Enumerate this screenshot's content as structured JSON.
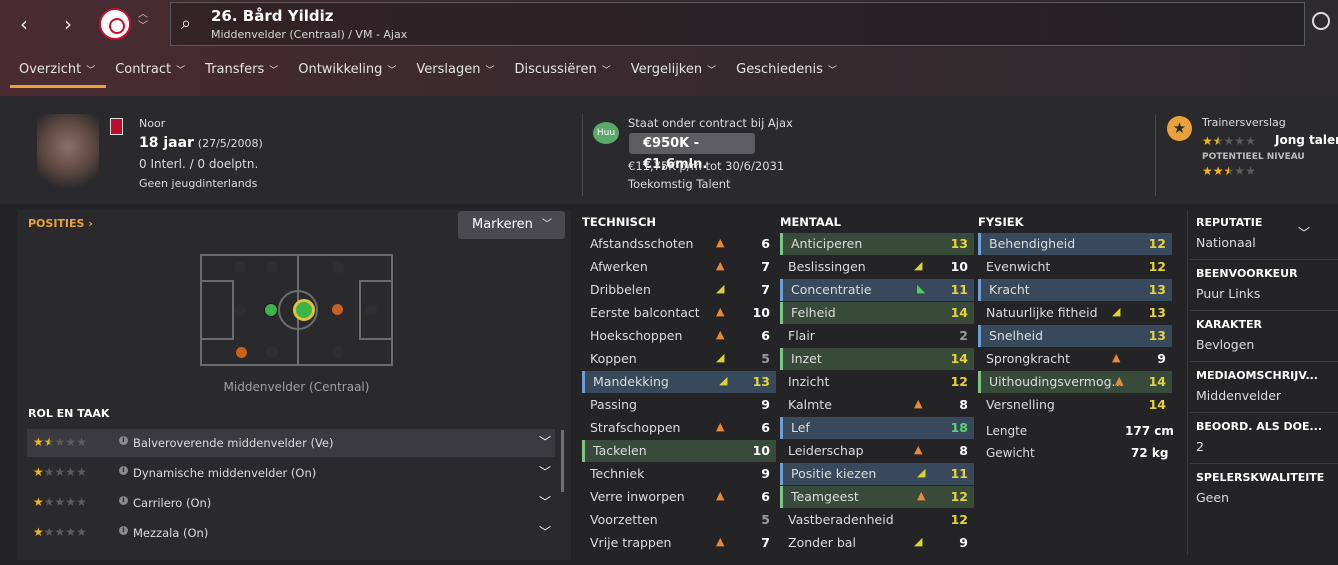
{
  "header": {
    "title": "26. Bård Yildiz",
    "subtitle": "Middenvelder (Centraal) / VM - Ajax"
  },
  "tabs": [
    {
      "label": "Overzicht"
    },
    {
      "label": "Contract"
    },
    {
      "label": "Transfers"
    },
    {
      "label": "Ontwikkeling"
    },
    {
      "label": "Verslagen"
    },
    {
      "label": "Discussiëren"
    },
    {
      "label": "Vergelijken"
    },
    {
      "label": "Geschiedenis"
    }
  ],
  "profile": {
    "nationality": "Noor",
    "age": "18 jaar",
    "dob": "(27/5/2008)",
    "caps": "0 Interl. / 0 doelptn.",
    "youth_caps": "Geen jeugdinterlands"
  },
  "contract": {
    "badge": "Huu",
    "status": "Staat onder contract bij Ajax",
    "value": "€950K - €1,6mln.",
    "wage": "€11,75K p/m tot 30/6/2031",
    "label": "Toekomstig Talent"
  },
  "scout": {
    "title": "Trainersverslag",
    "current_label": "Jong talent",
    "potential_title": "POTENTIEEL NIVEAU",
    "current_stars": 1.5,
    "potential_stars": 2.5
  },
  "positions": {
    "header": "POSITIES",
    "mark_button": "Markeren",
    "caption": "Middenvelder (Centraal)"
  },
  "roles": {
    "header": "ROL EN TAAK",
    "items": [
      {
        "name": "Balveroverende middenvelder (Ve)",
        "stars": 1.5
      },
      {
        "name": "Dynamische middenvelder (On)",
        "stars": 1
      },
      {
        "name": "Carrilero (On)",
        "stars": 1
      },
      {
        "name": "Mezzala (On)",
        "stars": 1
      }
    ]
  },
  "technical": {
    "header": "TECHNISCH",
    "rows": [
      {
        "name": "Afstandsschoten",
        "value": "6",
        "arrow": "up"
      },
      {
        "name": "Afwerken",
        "value": "7",
        "arrow": "up"
      },
      {
        "name": "Dribbelen",
        "value": "7",
        "arrow": "down"
      },
      {
        "name": "Eerste balcontact",
        "value": "10",
        "arrow": "up"
      },
      {
        "name": "Hoekschoppen",
        "value": "6",
        "arrow": "up"
      },
      {
        "name": "Koppen",
        "value": "5",
        "arrow": "down"
      },
      {
        "name": "Mandekking",
        "value": "13",
        "arrow": "down",
        "hl": "b"
      },
      {
        "name": "Passing",
        "value": "9",
        "arrow": ""
      },
      {
        "name": "Strafschoppen",
        "value": "6",
        "arrow": "up"
      },
      {
        "name": "Tackelen",
        "value": "10",
        "arrow": "",
        "hl": "g"
      },
      {
        "name": "Techniek",
        "value": "9",
        "arrow": ""
      },
      {
        "name": "Verre inworpen",
        "value": "6",
        "arrow": "up"
      },
      {
        "name": "Voorzetten",
        "value": "5",
        "arrow": ""
      },
      {
        "name": "Vrije trappen",
        "value": "7",
        "arrow": "up"
      }
    ]
  },
  "mental": {
    "header": "MENTAAL",
    "rows": [
      {
        "name": "Anticiperen",
        "value": "13",
        "arrow": "",
        "hl": "g"
      },
      {
        "name": "Beslissingen",
        "value": "10",
        "arrow": "down"
      },
      {
        "name": "Concentratie",
        "value": "11",
        "arrow": "green",
        "hl": "b"
      },
      {
        "name": "Felheid",
        "value": "14",
        "arrow": "",
        "hl": "g"
      },
      {
        "name": "Flair",
        "value": "2",
        "arrow": ""
      },
      {
        "name": "Inzet",
        "value": "14",
        "arrow": "",
        "hl": "g"
      },
      {
        "name": "Inzicht",
        "value": "12",
        "arrow": ""
      },
      {
        "name": "Kalmte",
        "value": "8",
        "arrow": "up"
      },
      {
        "name": "Lef",
        "value": "18",
        "arrow": "",
        "hl": "b"
      },
      {
        "name": "Leiderschap",
        "value": "8",
        "arrow": "up"
      },
      {
        "name": "Positie kiezen",
        "value": "11",
        "arrow": "down",
        "hl": "b"
      },
      {
        "name": "Teamgeest",
        "value": "12",
        "arrow": "up",
        "hl": "g"
      },
      {
        "name": "Vastberadenheid",
        "value": "12",
        "arrow": ""
      },
      {
        "name": "Zonder bal",
        "value": "9",
        "arrow": "down"
      }
    ]
  },
  "physical": {
    "header": "FYSIEK",
    "rows": [
      {
        "name": "Behendigheid",
        "value": "12",
        "arrow": "",
        "hl": "b"
      },
      {
        "name": "Evenwicht",
        "value": "12",
        "arrow": ""
      },
      {
        "name": "Kracht",
        "value": "13",
        "arrow": "",
        "hl": "b"
      },
      {
        "name": "Natuurlijke fitheid",
        "value": "13",
        "arrow": "down"
      },
      {
        "name": "Snelheid",
        "value": "13",
        "arrow": "",
        "hl": "b"
      },
      {
        "name": "Sprongkracht",
        "value": "9",
        "arrow": "up"
      },
      {
        "name": "Uithoudingsvermog...",
        "value": "14",
        "arrow": "up",
        "hl": "g"
      },
      {
        "name": "Versnelling",
        "value": "14",
        "arrow": ""
      }
    ],
    "height_label": "Lengte",
    "height": "177 cm",
    "weight_label": "Gewicht",
    "weight": "72 kg"
  },
  "info": {
    "items": [
      {
        "h": "REPUTATIE",
        "v": "Nationaal"
      },
      {
        "h": "BEENVOORKEUR",
        "v": "Puur Links"
      },
      {
        "h": "KARAKTER",
        "v": "Bevlogen"
      },
      {
        "h": "MEDIAOMSCHRIJV...",
        "v": "Middenvelder"
      },
      {
        "h": "BEOORD. ALS DOE...",
        "v": "2"
      },
      {
        "h": "SPELERSKWALITEITE",
        "v": "Geen"
      }
    ]
  },
  "colors": {
    "accent": "#e9a23b",
    "star": "#f2b51b",
    "value_yellow": "#e8d23a",
    "value_green": "#5fd07a",
    "value_white": "#ffffff",
    "value_grey": "#9a9a9e",
    "arrow_up": "#e58a3a",
    "arrow_down": "#d9d23a"
  }
}
